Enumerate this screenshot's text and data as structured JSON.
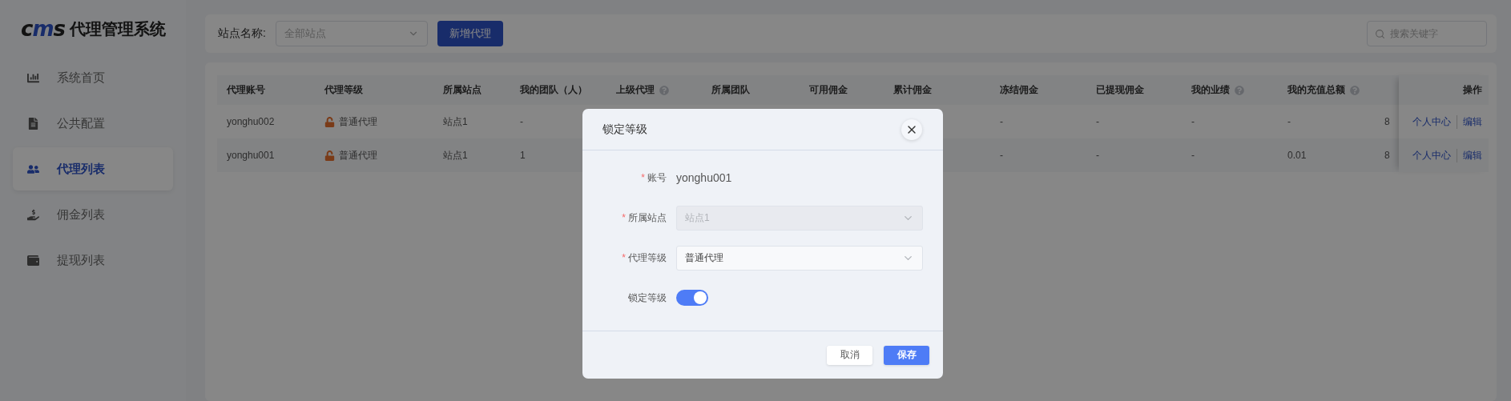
{
  "brand": {
    "logo": "cms",
    "title": "代理管理系统"
  },
  "sidebar": {
    "items": [
      {
        "label": "系统首页",
        "kind": "chart",
        "selected": false
      },
      {
        "label": "公共配置",
        "kind": "document",
        "selected": false
      },
      {
        "label": "代理列表",
        "kind": "users",
        "selected": true
      },
      {
        "label": "佣金列表",
        "kind": "hand",
        "selected": false
      },
      {
        "label": "提现列表",
        "kind": "wallet",
        "selected": false
      }
    ]
  },
  "filter": {
    "label": "站点名称:",
    "select_placeholder": "全部站点",
    "add_button": "新增代理"
  },
  "search": {
    "placeholder": "搜索关键字"
  },
  "table": {
    "columns": [
      {
        "label": "代理账号",
        "help": false
      },
      {
        "label": "代理等级",
        "help": false
      },
      {
        "label": "所属站点",
        "help": false
      },
      {
        "label": "我的团队（人）",
        "help": false
      },
      {
        "label": "上级代理",
        "help": true
      },
      {
        "label": "所属团队",
        "help": false
      },
      {
        "label": "可用佣金",
        "help": false
      },
      {
        "label": "累计佣金",
        "help": false
      },
      {
        "label": "冻结佣金",
        "help": false
      },
      {
        "label": "已提现佣金",
        "help": false
      },
      {
        "label": "我的业绩",
        "help": true
      },
      {
        "label": "我的充值总额",
        "help": true
      }
    ],
    "action_column": "操作",
    "rows": [
      {
        "account": "yonghu002",
        "level": {
          "text": "普通代理",
          "locked": false
        },
        "site": "站点1",
        "team": "-",
        "frozen_commission": "-",
        "withdrawn_commission": "-",
        "performance": "-",
        "recharge_total": "-",
        "column_13": "8",
        "actions": [
          "个人中心",
          "编辑"
        ]
      },
      {
        "account": "yonghu001",
        "level": {
          "text": "普通代理",
          "locked": false
        },
        "site": "站点1",
        "team": "1",
        "frozen_commission": "-",
        "withdrawn_commission": "-",
        "performance": "-",
        "recharge_total": "0.01",
        "column_13": "8",
        "actions": [
          "个人中心",
          "编辑"
        ]
      }
    ]
  },
  "dialog": {
    "title": "锁定等级",
    "fields": [
      {
        "kind": "text",
        "label": "账号",
        "required_mark": "*",
        "value": "yonghu001"
      },
      {
        "kind": "select",
        "label": "所属站点",
        "required_mark": "*",
        "value": "站点1",
        "disabled": true
      },
      {
        "kind": "select",
        "label": "代理等级",
        "required_mark": "*",
        "value": "普通代理",
        "disabled": false
      },
      {
        "kind": "switch",
        "label": "锁定等级",
        "on": true
      }
    ],
    "buttons": [
      {
        "label": "取消",
        "primary": false
      },
      {
        "label": "保存",
        "primary": true
      }
    ]
  }
}
